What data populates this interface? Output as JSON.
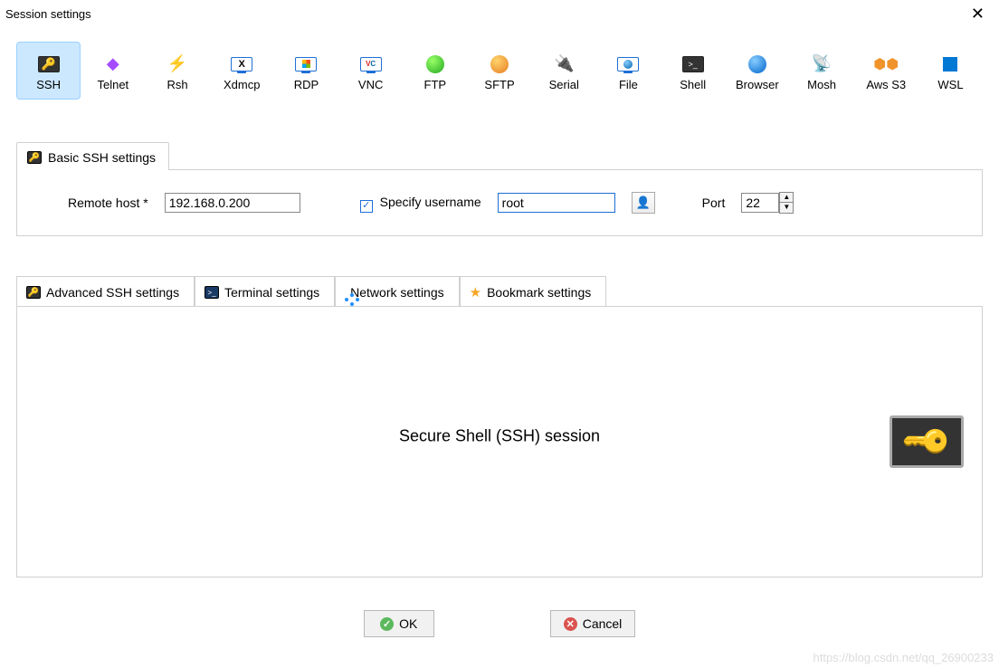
{
  "title": "Session settings",
  "close_glyph": "✕",
  "types": [
    {
      "id": "ssh",
      "label": "SSH"
    },
    {
      "id": "telnet",
      "label": "Telnet"
    },
    {
      "id": "rsh",
      "label": "Rsh"
    },
    {
      "id": "xdmcp",
      "label": "Xdmcp"
    },
    {
      "id": "rdp",
      "label": "RDP"
    },
    {
      "id": "vnc",
      "label": "VNC"
    },
    {
      "id": "ftp",
      "label": "FTP"
    },
    {
      "id": "sftp",
      "label": "SFTP"
    },
    {
      "id": "serial",
      "label": "Serial"
    },
    {
      "id": "file",
      "label": "File"
    },
    {
      "id": "shell",
      "label": "Shell"
    },
    {
      "id": "browser",
      "label": "Browser"
    },
    {
      "id": "mosh",
      "label": "Mosh"
    },
    {
      "id": "awss3",
      "label": "Aws S3"
    },
    {
      "id": "wsl",
      "label": "WSL"
    }
  ],
  "selected_type": "ssh",
  "basic_tab_label": "Basic SSH settings",
  "remote_host_label": "Remote host *",
  "remote_host_value": "192.168.0.200",
  "specify_username_label": "Specify username",
  "specify_username_checked": true,
  "username_value": "root",
  "port_label": "Port",
  "port_value": "22",
  "adv_tabs": [
    {
      "id": "advssh",
      "label": "Advanced SSH settings"
    },
    {
      "id": "term",
      "label": "Terminal settings"
    },
    {
      "id": "net",
      "label": "Network settings"
    },
    {
      "id": "book",
      "label": "Bookmark settings"
    }
  ],
  "session_name": "Secure Shell (SSH) session",
  "buttons": {
    "ok": "OK",
    "cancel": "Cancel"
  },
  "watermark": "https://blog.csdn.net/qq_26900233"
}
